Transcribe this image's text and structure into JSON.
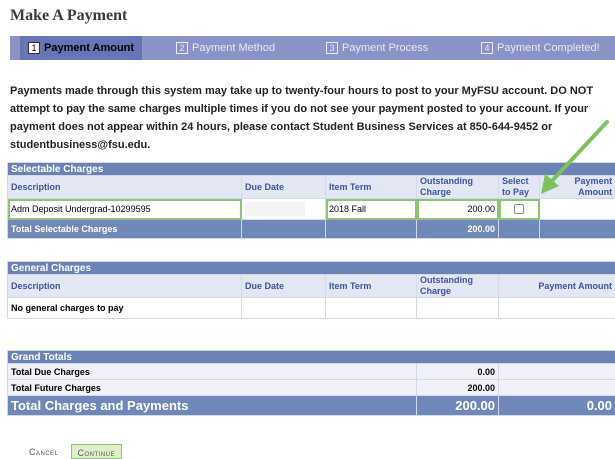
{
  "page": {
    "title": "Make A Payment"
  },
  "steps": [
    {
      "num": "1",
      "label": "Payment Amount",
      "active": true
    },
    {
      "num": "2",
      "label": "Payment Method",
      "active": false
    },
    {
      "num": "3",
      "label": "Payment Process",
      "active": false
    },
    {
      "num": "4",
      "label": "Payment Completed!",
      "active": false
    }
  ],
  "notice": "Payments made through this system may take up to twenty-four hours to post to your MyFSU account. DO NOT attempt to pay the same charges multiple times if you do not see your payment posted to your account. If your payment does not appear within 24 hours, please contact Student Business Services at 850-644-9452 or studentbusiness@fsu.edu.",
  "selectable": {
    "section_title": "Selectable Charges",
    "columns": {
      "description": "Description",
      "due_date": "Due Date",
      "item_term": "Item Term",
      "outstanding": "Outstanding Charge",
      "select": "Select to Pay",
      "payment": "Payment Amount"
    },
    "row": {
      "description": "Adm Deposit Undergrad-10299595",
      "due_date": "",
      "item_term": "2018 Fall",
      "outstanding": "200.00"
    },
    "total": {
      "label": "Total Selectable Charges",
      "outstanding": "200.00"
    }
  },
  "general": {
    "section_title": "General Charges",
    "columns": {
      "description": "Description",
      "due_date": "Due Date",
      "item_term": "Item Term",
      "outstanding": "Outstanding Charge",
      "payment": "Payment Amount"
    },
    "empty": "No general charges to pay"
  },
  "grand": {
    "section_title": "Grand Totals",
    "due_label": "Total Due Charges",
    "due_value": "0.00",
    "future_label": "Total Future Charges",
    "future_value": "200.00",
    "total_label": "Total Charges and Payments",
    "total_value": "200.00",
    "payment_value": "0.00"
  },
  "buttons": {
    "cancel": "Cancel",
    "continue": "Continue"
  },
  "colors": {
    "header_bar": "#8b93c6",
    "section_header": "#6b83b4",
    "highlight": "#8cc575",
    "arrow": "#7cc15a"
  }
}
